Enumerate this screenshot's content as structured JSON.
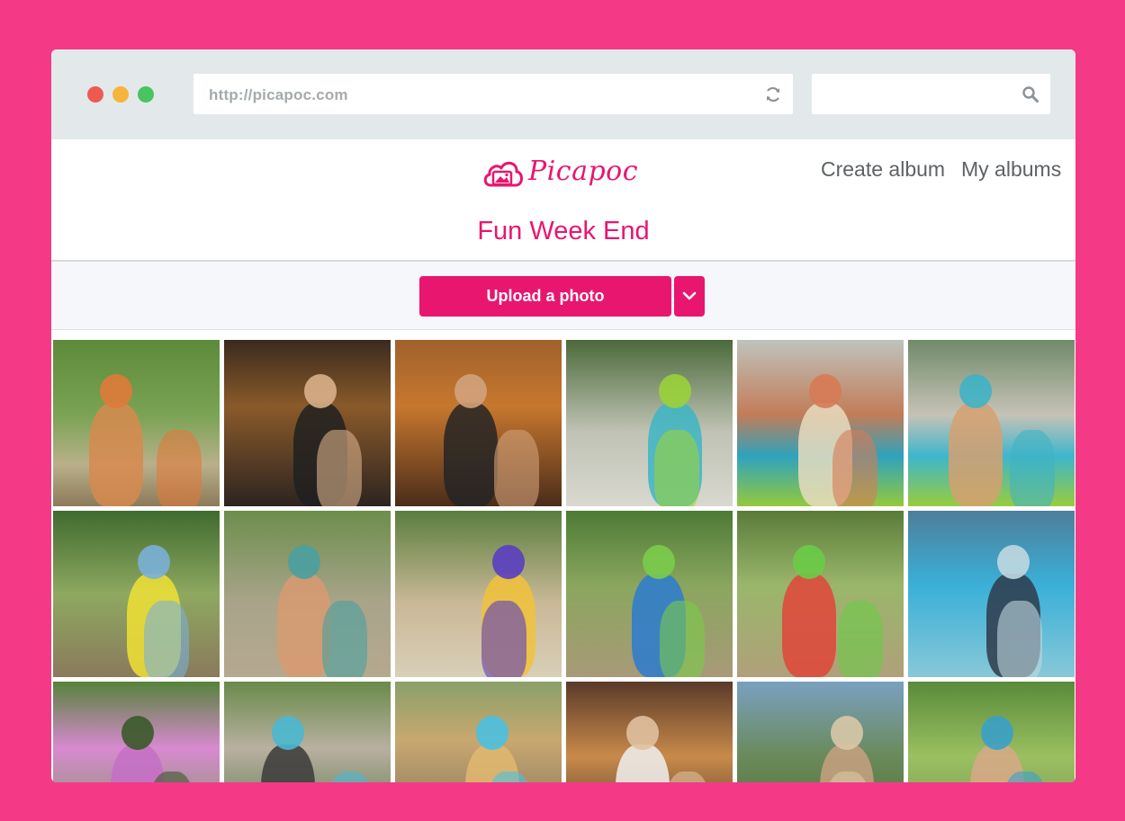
{
  "browser": {
    "url": "http://picapoc.com",
    "search_value": "",
    "icons": {
      "reload": "reload-icon",
      "search": "search-icon"
    }
  },
  "header": {
    "logo_text": "Picapoc",
    "nav": [
      {
        "label": "Create album"
      },
      {
        "label": "My albums"
      }
    ],
    "album_title": "Fun Week End"
  },
  "toolbar": {
    "upload_label": "Upload a photo",
    "dropdown_icon": "chevron-down-icon"
  },
  "colors": {
    "background": "#f43a86",
    "accent": "#e8166f",
    "chrome": "#e3e9eb",
    "toolbar_bg": "#f5f7fa",
    "nav_text": "#5e6265"
  },
  "photos": [
    {
      "bg": "linear-gradient(180deg,#5d8a3a 0%,#7aa354 45%,#b9b08a 75%,#8d7a5a 100%)",
      "fig": "#d7894f",
      "fig2": "#e07a3a"
    },
    {
      "bg": "linear-gradient(180deg,#3a2a1e 0%,#8a5a2a 40%,#2d2420 100%)",
      "fig": "#202020",
      "fig2": "#d8b08a"
    },
    {
      "bg": "linear-gradient(180deg,#a0612c 0%,#c7772e 40%,#4a2c1a 100%)",
      "fig": "#252525",
      "fig2": "#d2a27c"
    },
    {
      "bg": "linear-gradient(180deg,#4b6a3a 0%,#bfc2b4 55%,#d9d8d0 100%)",
      "fig": "#3cb5c6",
      "fig2": "#9ad23a"
    },
    {
      "bg": "linear-gradient(180deg,#bfc3bd 0%,#c27c58 45%,#2ea3bd 70%,#95c93c 100%)",
      "fig": "#e8dcc0",
      "fig2": "#d77a55"
    },
    {
      "bg": "linear-gradient(180deg,#708a6a 0%,#c6c2b6 45%,#3eb6cc 70%,#98cc3c 100%)",
      "fig": "#d6a070",
      "fig2": "#3fb2c5"
    },
    {
      "bg": "linear-gradient(180deg,#3f6b2f 0%,#8ea860 50%,#8a7a5c 100%)",
      "fig": "#f0e035",
      "fig2": "#7ab0d8"
    },
    {
      "bg": "linear-gradient(180deg,#6c8e4c 0%,#a9a48a 55%,#b5a990 100%)",
      "fig": "#d89a70",
      "fig2": "#4aa0a0"
    },
    {
      "bg": "linear-gradient(180deg,#5a7e3e 0%,#c9b896 55%,#d8cfb8 100%)",
      "fig": "#f2c23a",
      "fig2": "#5a3ec0"
    },
    {
      "bg": "linear-gradient(180deg,#4d7a36 0%,#8aa65e 45%,#a89a78 100%)",
      "fig": "#2b7bd0",
      "fig2": "#7acc4a"
    },
    {
      "bg": "linear-gradient(180deg,#5a7c3a 0%,#9ab66a 45%,#b0a07a 100%)",
      "fig": "#e0453a",
      "fig2": "#6acc48"
    },
    {
      "bg": "linear-gradient(180deg,#4e7e9a 0%,#3ab0d8 45%,#88c8d8 100%)",
      "fig": "#2f3a4a",
      "fig2": "#c0d8e0"
    },
    {
      "bg": "linear-gradient(180deg,#55823a 0%,#d88ad0 40%,#6a9a4a 100%)",
      "fig": "#c46ec6",
      "fig2": "#3a5a2a"
    },
    {
      "bg": "linear-gradient(180deg,#6a8a4a 0%,#b8b0a0 40%,#4a6a3a 100%)",
      "fig": "#3a3a3a",
      "fig2": "#4ab8d0"
    },
    {
      "bg": "linear-gradient(180deg,#8aa06a 0%,#c8a870 35%,#7a6a5a 100%)",
      "fig": "#e0b870",
      "fig2": "#4ac0e0"
    },
    {
      "bg": "linear-gradient(180deg,#5a3a2a 0%,#c88a4a 45%,#3a2a2a 100%)",
      "fig": "#f0f0f0",
      "fig2": "#e0c0a0"
    },
    {
      "bg": "linear-gradient(180deg,#7aa0c0 0%,#6a8a5a 45%,#4a6a3a 100%)",
      "fig": "#c8a080",
      "fig2": "#d8c8a8"
    },
    {
      "bg": "linear-gradient(180deg,#5a8a3a 0%,#9ac060 45%,#7a8a5a 100%)",
      "fig": "#d8a888",
      "fig2": "#3aa0c8"
    }
  ]
}
